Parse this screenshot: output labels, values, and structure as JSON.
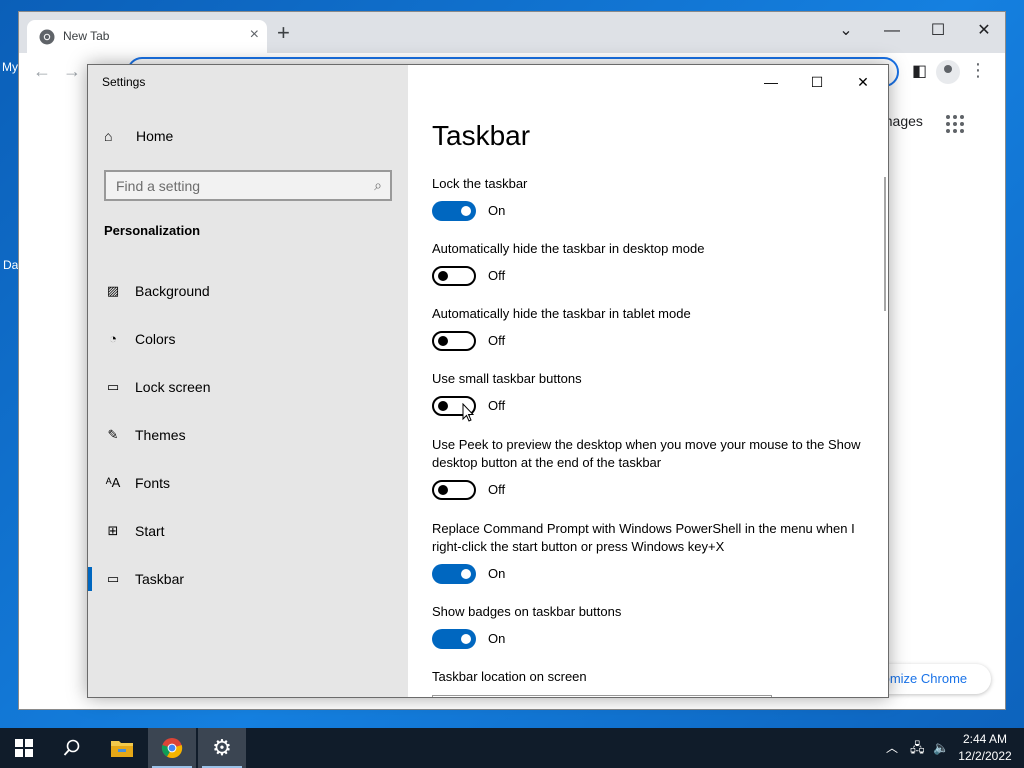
{
  "desktop": {
    "label_top": "My",
    "label_mid": "Da"
  },
  "chrome": {
    "tab_title": "New Tab",
    "tab_close": "×",
    "new_tab": "+",
    "images_link": "Images",
    "customize_label": "tomize Chrome"
  },
  "settings": {
    "app_title": "Settings",
    "home_label": "Home",
    "search_placeholder": "Find a setting",
    "section_title": "Personalization",
    "nav_items": [
      {
        "label": "Background",
        "icon": "image-icon"
      },
      {
        "label": "Colors",
        "icon": "palette-icon"
      },
      {
        "label": "Lock screen",
        "icon": "lock-screen-icon"
      },
      {
        "label": "Themes",
        "icon": "themes-icon"
      },
      {
        "label": "Fonts",
        "icon": "fonts-icon"
      },
      {
        "label": "Start",
        "icon": "start-icon"
      },
      {
        "label": "Taskbar",
        "icon": "taskbar-icon",
        "selected": true
      }
    ],
    "page_title": "Taskbar",
    "options": [
      {
        "label": "Lock the taskbar",
        "state": "On"
      },
      {
        "label": "Automatically hide the taskbar in desktop mode",
        "state": "Off"
      },
      {
        "label": "Automatically hide the taskbar in tablet mode",
        "state": "Off"
      },
      {
        "label": "Use small taskbar buttons",
        "state": "Off"
      },
      {
        "label": "Use Peek to preview the desktop when you move your mouse to the Show desktop button at the end of the taskbar",
        "state": "Off"
      },
      {
        "label": "Replace Command Prompt with Windows PowerShell in the menu when I right-click the start button or press Windows key+X",
        "state": "On"
      },
      {
        "label": "Show badges on taskbar buttons",
        "state": "On"
      }
    ],
    "location_label": "Taskbar location on screen"
  },
  "taskbar": {
    "time": "2:44 AM",
    "date": "12/2/2022"
  },
  "colors": {
    "accent": "#0067c0",
    "nav_bg": "#e6e6e6",
    "taskbar_bg": "#101c2a",
    "chrome_blue": "#1a73e8"
  }
}
